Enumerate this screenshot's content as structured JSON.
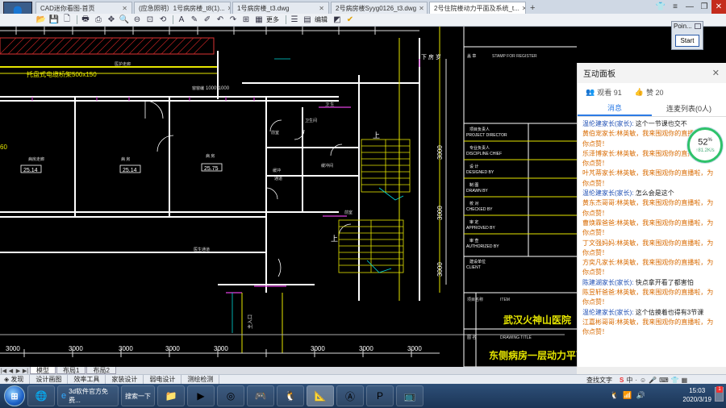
{
  "tabs": [
    {
      "label": "CAD迷你看图-首页",
      "active": false
    },
    {
      "label": "(应急照明）1号病房楼_t8(1)...",
      "active": false
    },
    {
      "label": "1号病房楼_t3.dwg",
      "active": false
    },
    {
      "label": "2号病房楼Syyg0126_t3.dwg",
      "active": false
    },
    {
      "label": "2号住院楼动力平面及系统_t...",
      "active": true
    }
  ],
  "new_tab": "+",
  "toolbar": {
    "more": "更多",
    "edit": "编辑"
  },
  "poin_widget": {
    "label": "Poin...",
    "start": "Start"
  },
  "drawing": {
    "dims_bottom": [
      "3000",
      "3000",
      "3000",
      "3000",
      "3000",
      "3000",
      "3000",
      "3000"
    ],
    "dims_right": [
      "3000",
      "3000",
      "3000"
    ],
    "room_values": [
      "25.14",
      "25.14",
      "25.75"
    ],
    "window_label": "1000*1000",
    "left_label": "托盘式电缆桥架500x150",
    "up_labels": [
      "上",
      "上"
    ],
    "value_60": "60",
    "titleblock": {
      "stamp_label": "盖 章",
      "stamp_en": "STAMP FOR REGISTER",
      "rows": [
        {
          "cn": "项目负责人",
          "en": "PROJECT DIRECTOR"
        },
        {
          "cn": "专业负责人",
          "en": "DISCIPLINE CHIEF"
        },
        {
          "cn": "设 计",
          "en": "DESIGNED BY"
        },
        {
          "cn": "制 图",
          "en": "DRAWN BY"
        },
        {
          "cn": "校 对",
          "en": "CHECKED BY"
        },
        {
          "cn": "审 定",
          "en": "APPROVED BY"
        },
        {
          "cn": "审 查",
          "en": "AUTHORIZED BY"
        },
        {
          "cn": "建设单位",
          "en": "CLIENT"
        }
      ],
      "item_cn": "项目名称",
      "item_en": "ITEM",
      "project": "武汉火神山医院",
      "title_cn": "图 名",
      "title_en": "DRAWING TITLE",
      "drawing_title": "东侧病房一层动力平面图"
    }
  },
  "layout_tabs": [
    {
      "label": "模型",
      "active": true
    },
    {
      "label": "布局1",
      "active": false
    },
    {
      "label": "布局2",
      "active": false
    }
  ],
  "panel": {
    "title": "互动面板",
    "viewers": "观看 91",
    "likes": "赞 20",
    "tabs": [
      "消息",
      "连麦列表(0人)"
    ],
    "messages": [
      {
        "name": "温伦建家长(家长):",
        "text": " 这个一节课也交不",
        "style": "n"
      },
      {
        "name": "黄伯宠家长:",
        "text": "林英敏，我来围观你的直播",
        "style": "t"
      },
      {
        "name": "你点赞！",
        "text": "",
        "style": "t"
      },
      {
        "name": "乐泽博家长:",
        "text": "林英敏，我来围观你的直播啦，为",
        "style": "t"
      },
      {
        "name": "你点赞！",
        "text": "",
        "style": "t"
      },
      {
        "name": "叶芃蒂家长:",
        "text": "林英敏，我来围观你的直播啦，为",
        "style": "t"
      },
      {
        "name": "你点赞！",
        "text": "",
        "style": "t"
      },
      {
        "name": "温伦建家长(家长):",
        "text": " 怎么会是这个",
        "style": "n"
      },
      {
        "name": "黄东杰哥哥:",
        "text": "林英敏，我来围观你的直播啦，为",
        "style": "t"
      },
      {
        "name": "你点赞！",
        "text": "",
        "style": "t"
      },
      {
        "name": "曹焕霖爸爸:",
        "text": "林英敏，我来围观你的直播啦，为",
        "style": "t"
      },
      {
        "name": "你点赞！",
        "text": "",
        "style": "t"
      },
      {
        "name": "丁文强妈妈:",
        "text": "林英敏，我来围观你的直播啦，为",
        "style": "t"
      },
      {
        "name": "你点赞！",
        "text": "",
        "style": "t"
      },
      {
        "name": "方奕凡家长:",
        "text": "林英敏，我来围观你的直播啦，为",
        "style": "t"
      },
      {
        "name": "你点赞！",
        "text": "",
        "style": "t"
      },
      {
        "name": "陈建湖家长(家长):",
        "text": " 快点拿开看了都害怕",
        "style": "n"
      },
      {
        "name": "陈昱轩爸爸:",
        "text": "林英敏，我来围观你的直播啦，为",
        "style": "t"
      },
      {
        "name": "你点赞！",
        "text": "",
        "style": "t"
      },
      {
        "name": "温伦建家长(家长):",
        "text": " 这个估摸着也得有3节课",
        "style": "n"
      },
      {
        "name": "江嘉彬哥哥:",
        "text": "林英敏，我来围观你的直播啦，为",
        "style": "t"
      },
      {
        "name": "你点赞！",
        "text": "",
        "style": "t"
      }
    ],
    "gauge_pct": "52",
    "gauge_speed": "↑81.2K/s"
  },
  "menubar": {
    "items": [
      "发现",
      "设计画图",
      "效率工具",
      "家装设计",
      "弱电设计",
      "测绘检测"
    ],
    "find_text": "查找文字"
  },
  "taskbar": {
    "browser_label": "3d软件官方免费...",
    "search_label": "搜索一下",
    "time": "15:03",
    "date": "2020/3/19",
    "badge": "1"
  },
  "colors": {
    "accent": "#2c7be5",
    "cad_bg": "#000000",
    "orange_msg": "#d86a00",
    "blue_name": "#1f4fb4"
  }
}
